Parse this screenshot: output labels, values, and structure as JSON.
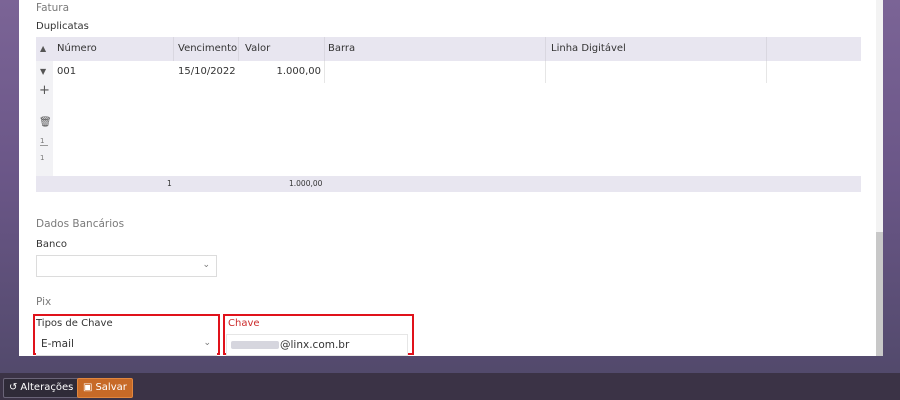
{
  "fatura": {
    "title": "Fatura",
    "duplicatas_label": "Duplicatas",
    "columns": [
      "Número",
      "Vencimento",
      "Valor",
      "Barra",
      "Linha Digitável"
    ],
    "rows": [
      {
        "numero": "001",
        "vencimento": "15/10/2022",
        "valor": "1.000,00",
        "barra": "",
        "linha": ""
      }
    ],
    "side_controls": {
      "page_top": "1",
      "page_bottom": "1"
    },
    "footer": {
      "count": "1",
      "total": "1.000,00"
    }
  },
  "dados_bancarios": {
    "title": "Dados Bancários",
    "banco_label": "Banco",
    "banco_value": ""
  },
  "pix": {
    "title": "Pix",
    "tipo_label": "Tipos de Chave",
    "tipo_value": "E-mail",
    "chave_label": "Chave",
    "chave_value": "@linx.com.br"
  },
  "footer_buttons": {
    "alteracoes": "Alterações",
    "salvar": "Salvar"
  },
  "colors": {
    "highlight": "#e0121b",
    "save": "#c76a27"
  }
}
